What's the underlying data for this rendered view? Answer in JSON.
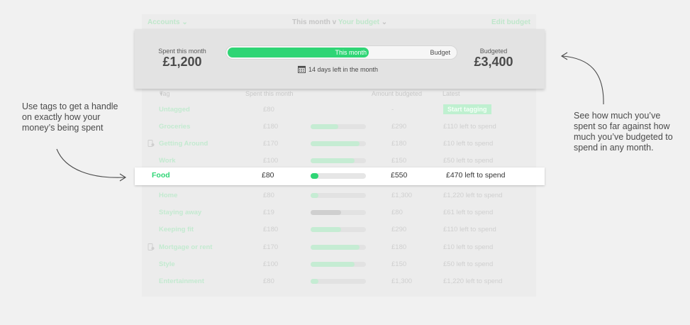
{
  "topbar": {
    "accounts": "Accounts",
    "this_month": "This month",
    "your_budget": "Your budget",
    "edit_budget": "Edit budget"
  },
  "summary": {
    "spent_label": "Spent this month",
    "spent_value": "£1,200",
    "bar_progress_label": "This month",
    "bar_end_label": "Budget",
    "progress_fraction": 0.62,
    "days_left": "14 days left in the month",
    "budgeted_label": "Budgeted",
    "budgeted_value": "£3,400"
  },
  "table": {
    "columns": [
      "Tag",
      "Spent this month",
      "Amount budgeted",
      "Latest"
    ],
    "untagged": {
      "tag": "Untagged",
      "spent": "£80",
      "budgeted": "-",
      "latest": "Start tagging"
    },
    "rows_above": [
      {
        "tag": "Groceries",
        "spent": "£180",
        "budgeted": "£290",
        "latest": "£110 left to spend",
        "fill": 0.5,
        "person": false
      },
      {
        "tag": "Getting Around",
        "spent": "£170",
        "budgeted": "£180",
        "latest": "£10 left to spend",
        "fill": 0.88,
        "person": true
      },
      {
        "tag": "Work",
        "spent": "£100",
        "budgeted": "£150",
        "latest": "£50 left to spend",
        "fill": 0.8,
        "person": false
      }
    ],
    "food": {
      "tag": "Food",
      "spent": "£80",
      "budgeted": "£550",
      "latest": "£470 left to spend",
      "fill": 0.14
    },
    "rows_below": [
      {
        "tag": "Home",
        "spent": "£80",
        "budgeted": "£1,300",
        "latest": "£1,220 left to spend",
        "fill": 0.14,
        "person": false,
        "gray": false
      },
      {
        "tag": "Staying away",
        "spent": "£19",
        "budgeted": "£80",
        "latest": "£61 left to spend",
        "fill": 0.55,
        "person": false,
        "gray": true
      },
      {
        "tag": "Keeping fit",
        "spent": "£180",
        "budgeted": "£290",
        "latest": "£110 left to spend",
        "fill": 0.55,
        "person": false,
        "gray": false
      },
      {
        "tag": "Mortgage or rent",
        "spent": "£170",
        "budgeted": "£180",
        "latest": "£10 left to spend",
        "fill": 0.88,
        "person": true,
        "gray": false
      },
      {
        "tag": "Style",
        "spent": "£100",
        "budgeted": "£150",
        "latest": "£50 left to spend",
        "fill": 0.8,
        "person": false,
        "gray": false
      },
      {
        "tag": "Entertainment",
        "spent": "£80",
        "budgeted": "£1,300",
        "latest": "£1,220 left to spend",
        "fill": 0.14,
        "person": false,
        "gray": false
      }
    ]
  },
  "annotations": {
    "left": "Use tags to get a handle on exactly how your money’s being spent",
    "right": "See how much you’ve spent so far against how much you’ve budgeted to spend in any month."
  }
}
